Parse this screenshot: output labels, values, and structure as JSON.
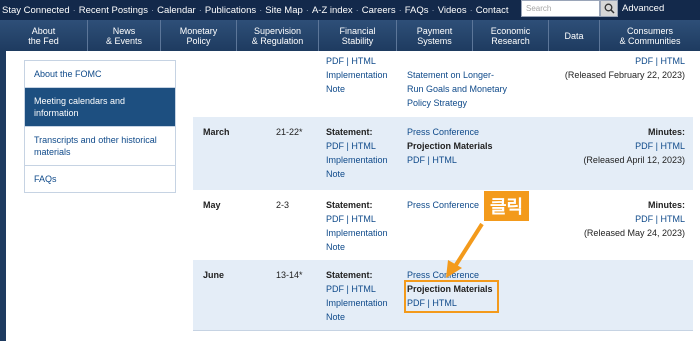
{
  "topbar": {
    "links": [
      "Stay Connected",
      "Recent Postings",
      "Calendar",
      "Publications",
      "Site Map",
      "A-Z index",
      "Careers",
      "FAQs",
      "Videos",
      "Contact"
    ],
    "search_placeholder": "Search",
    "advanced": "Advanced"
  },
  "nav": [
    {
      "l1": "About",
      "l2": "the Fed"
    },
    {
      "l1": "News",
      "l2": "& Events"
    },
    {
      "l1": "Monetary",
      "l2": "Policy"
    },
    {
      "l1": "Supervision",
      "l2": "& Regulation"
    },
    {
      "l1": "Financial",
      "l2": "Stability"
    },
    {
      "l1": "Payment",
      "l2": "Systems"
    },
    {
      "l1": "Economic",
      "l2": "Research"
    },
    {
      "l1": "Data",
      "l2": ""
    },
    {
      "l1": "Consumers",
      "l2": "& Communities"
    }
  ],
  "sidenav": [
    {
      "label": "About the FOMC",
      "active": false
    },
    {
      "label": "Meeting calendars and information",
      "active": true
    },
    {
      "label": "Transcripts and other historical materials",
      "active": false
    },
    {
      "label": "FAQs",
      "active": false
    }
  ],
  "rows": {
    "feb": {
      "links": "PDF | HTML",
      "impl": "Implementation",
      "note": "Note",
      "stmt_line1": "Statement on Longer-",
      "stmt_line2": "Run Goals and Monetary",
      "stmt_line3": "Policy Strategy",
      "minutes_links": "PDF | HTML",
      "released": "(Released February 22, 2023)"
    },
    "march": {
      "month": "March",
      "dates": "21-22*",
      "statement": "Statement:",
      "links": "PDF | HTML",
      "impl": "Implementation",
      "note": "Note",
      "press": "Press Conference",
      "proj": "Projection Materials",
      "proj_links": "PDF | HTML",
      "minutes": "Minutes:",
      "minutes_links": "PDF | HTML",
      "released": "(Released April 12, 2023)"
    },
    "may": {
      "month": "May",
      "dates": "2-3",
      "statement": "Statement:",
      "links": "PDF | HTML",
      "impl": "Implementation",
      "note": "Note",
      "press": "Press Conference",
      "minutes": "Minutes:",
      "minutes_links": "PDF | HTML",
      "released": "(Released May 24, 2023)"
    },
    "june": {
      "month": "June",
      "dates": "13-14*",
      "statement": "Statement:",
      "links": "PDF | HTML",
      "impl": "Implementation",
      "note": "Note",
      "press": "Press Conference",
      "proj": "Projection Materials",
      "proj_links": "PDF | HTML"
    }
  },
  "annotation": {
    "label": "클릭",
    "color": "#f39a1b"
  }
}
